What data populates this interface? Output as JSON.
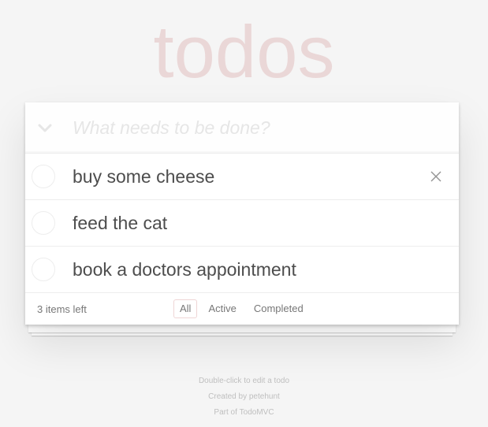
{
  "app": {
    "title": "todos",
    "new_todo_placeholder": "What needs to be done?",
    "toggle_all_icon": "chevron-down-icon"
  },
  "todos": [
    {
      "text": "buy some cheese",
      "completed": false,
      "show_destroy": true
    },
    {
      "text": "feed the cat",
      "completed": false,
      "show_destroy": false
    },
    {
      "text": "book a doctors appointment",
      "completed": false,
      "show_destroy": false
    }
  ],
  "footer": {
    "count_text": "3 items left",
    "filters": [
      {
        "label": "All",
        "selected": true
      },
      {
        "label": "Active",
        "selected": false
      },
      {
        "label": "Completed",
        "selected": false
      }
    ]
  },
  "info": {
    "edit_hint": "Double-click to edit a todo",
    "created_by_prefix": "Created by ",
    "created_by_name": "petehunt",
    "part_of_prefix": "Part of ",
    "part_of_name": "TodoMVC"
  },
  "colors": {
    "background": "#f5f5f5",
    "title": "rgba(175, 47, 47, 0.15)",
    "text": "#4d4d4d",
    "muted": "#777777",
    "placeholder": "#e6e6e6"
  }
}
